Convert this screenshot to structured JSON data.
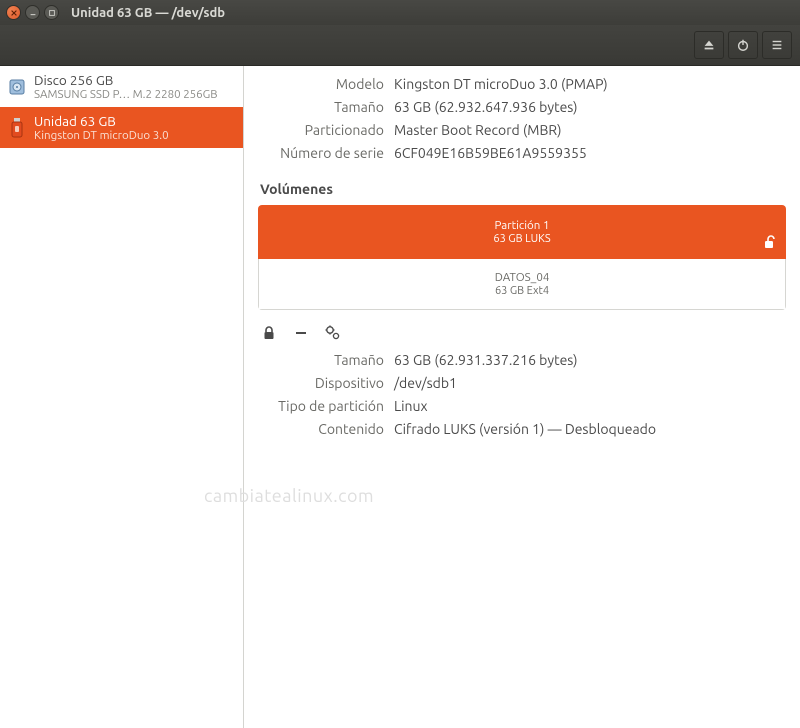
{
  "window": {
    "title": "Unidad 63 GB — /dev/sdb"
  },
  "toolbar": {
    "eject": "eject-icon",
    "power": "power-icon",
    "menu": "hamburger-icon"
  },
  "sidebar": {
    "disks": [
      {
        "name": "Disco 256 GB",
        "sub": "SAMSUNG SSD P… M.2 2280 256GB",
        "icon": "hdd-icon",
        "selected": false
      },
      {
        "name": "Unidad 63 GB",
        "sub": "Kingston DT microDuo 3.0",
        "icon": "usb-drive-icon",
        "selected": true
      }
    ]
  },
  "drive": {
    "labels": {
      "model": "Modelo",
      "size": "Tamaño",
      "partitioning": "Particionado",
      "serial": "Número de serie"
    },
    "model": "Kingston DT microDuo 3.0 (PMAP)",
    "size": "63 GB (62.932.647.936 bytes)",
    "partitioning": "Master Boot Record (MBR)",
    "serial": "6CF049E16B59BE61A9559355"
  },
  "volumes": {
    "heading": "Volúmenes",
    "luks": {
      "line1": "Partición 1",
      "line2": "63 GB LUKS"
    },
    "fs": {
      "line1": "DATOS_04",
      "line2": "63 GB Ext4"
    }
  },
  "partition": {
    "labels": {
      "size": "Tamaño",
      "device": "Dispositivo",
      "type": "Tipo de partición",
      "content": "Contenido"
    },
    "size": "63 GB (62.931.337.216 bytes)",
    "device": "/dev/sdb1",
    "type": "Linux",
    "content": "Cifrado LUKS (versión 1) — Desbloqueado"
  },
  "watermark": "cambiatealinux.com"
}
